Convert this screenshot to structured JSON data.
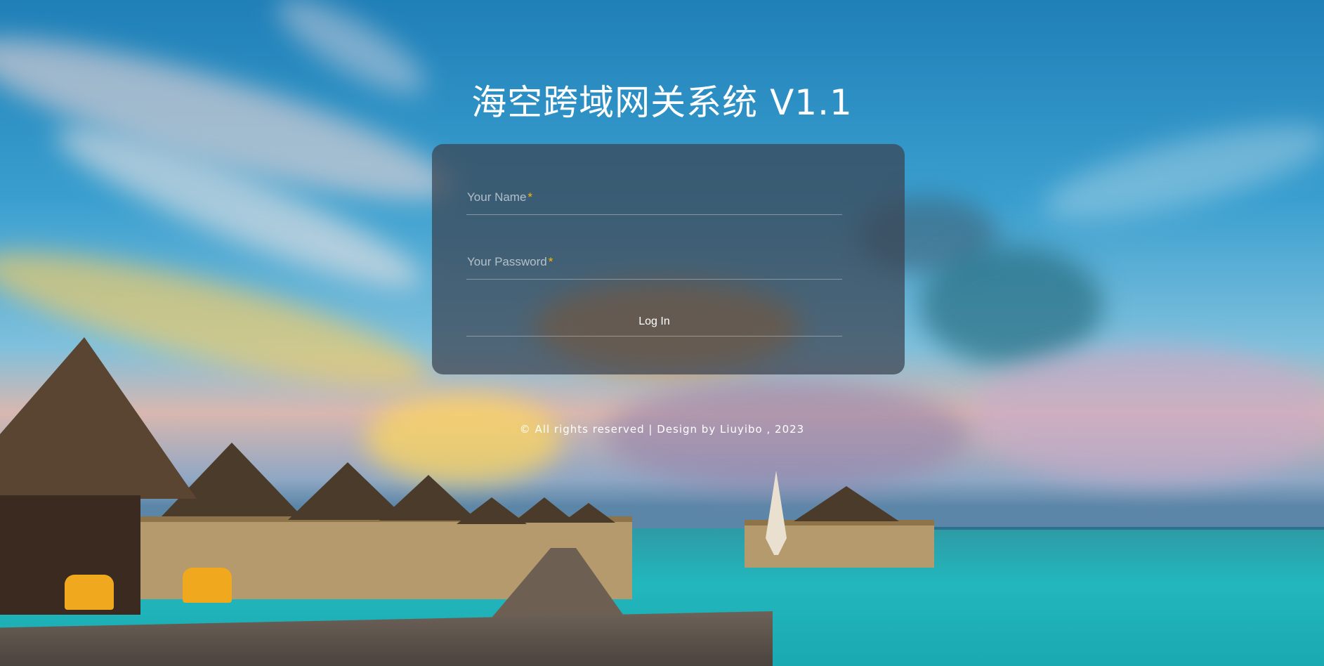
{
  "app": {
    "title": "海空跨域网关系统 V1.1"
  },
  "login": {
    "name_placeholder": "Your Name",
    "password_placeholder": "Your Password",
    "required_mark": "*",
    "name_value": "",
    "password_value": "",
    "submit_label": "Log In"
  },
  "footer": {
    "text": "© All rights reserved | Design by Liuyibo , 2023"
  },
  "colors": {
    "card_background": "#3a4250",
    "required_mark": "#ffb800",
    "text": "#ffffff"
  }
}
